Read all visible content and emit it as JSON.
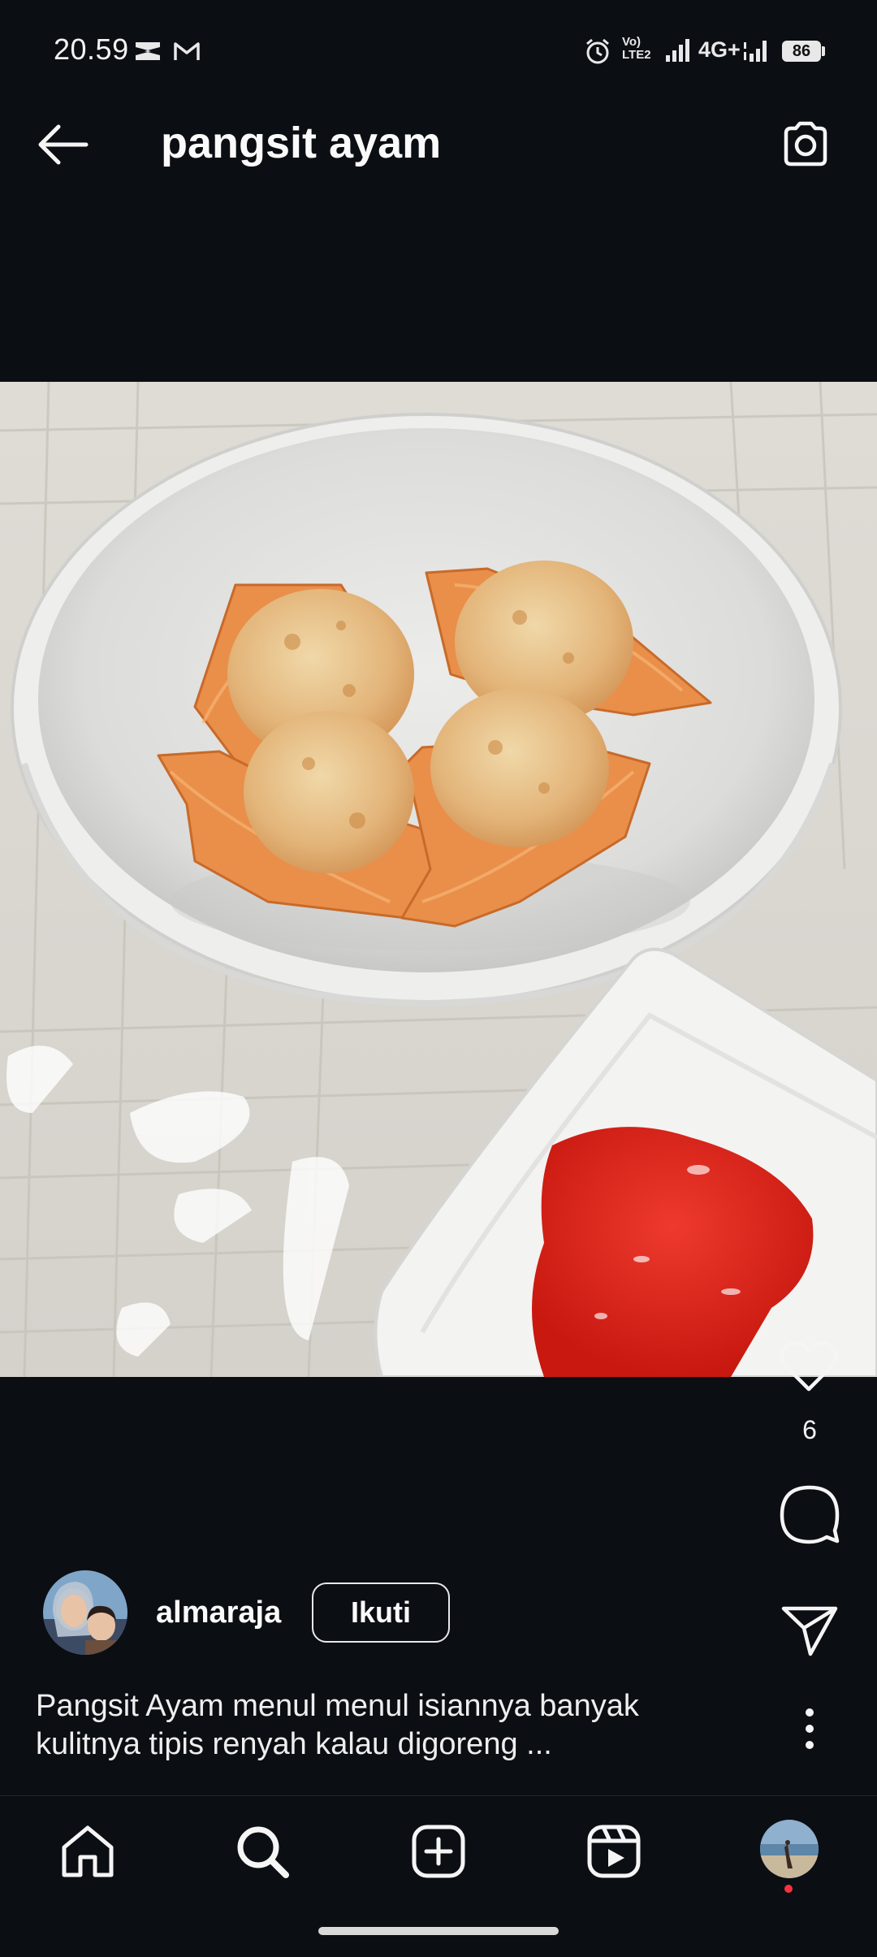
{
  "status_bar": {
    "time": "20.59",
    "network": "4G+",
    "battery": "86",
    "volte_label_top": "Vo)",
    "volte_label_bottom": "LTE2"
  },
  "header": {
    "title": "pangsit ayam"
  },
  "post": {
    "like_count": "6",
    "author": {
      "username": "almaraja",
      "follow_label": "Ikuti"
    },
    "caption_line1": "Pangsit Ayam menul menul isiannya banyak",
    "caption_line2": "kulitnya tipis renyah kalau digoreng ..."
  },
  "icons": {
    "back": "arrow-left-icon",
    "camera": "camera-icon",
    "like": "heart-icon",
    "comment": "comment-icon",
    "share": "send-icon",
    "more": "more-vertical-icon",
    "home": "home-icon",
    "search": "search-icon",
    "create": "plus-square-icon",
    "reels": "reels-icon",
    "profile": "profile-avatar"
  },
  "colors": {
    "background": "#0b0e13",
    "text": "#f5f5f5",
    "notification_dot": "#ff3040"
  }
}
